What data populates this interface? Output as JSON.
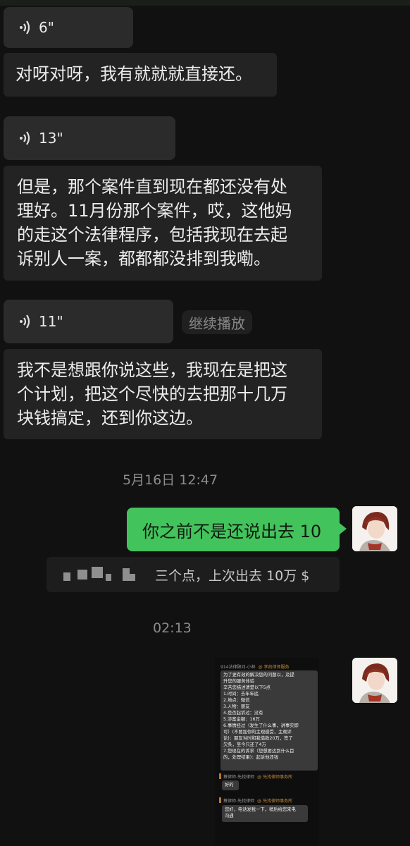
{
  "messages": {
    "voice1": {
      "duration": "6\""
    },
    "text1": "对呀对呀，我有就就就直接还。",
    "voice2": {
      "duration": "13\""
    },
    "text2_lines": [
      "但是，那个案件直到现在都还没有处",
      "理好。11月份那个案件，哎，这他妈",
      "的走这个法律程序，包括我现在去起",
      "诉别人一案，都都都没排到我嘞。"
    ],
    "voice3": {
      "duration": "11\""
    },
    "continue_play": "继续播放",
    "text3_lines": [
      "我不是想跟你说这些，我现在是把这",
      "个计划，把这个尽快的去把那十几万",
      "块钱搞定，还到你这边。"
    ],
    "timestamp1": "5月16日 12:47",
    "sent1": "你之前不是还说出去 10",
    "quote_reply": "三个点，上次出去 10万 $",
    "timestamp2": "02:13"
  },
  "screenshot": {
    "header1": {
      "name": "914法律顾问-小林",
      "brand": "@ 李凯律师服务"
    },
    "card1_lines": [
      "为了更有效的解决您的问题以，及提",
      "升您的服务体验",
      "辛苦您描述清楚以下5点",
      "1.时间：去年年底",
      "2.地点：微信",
      "3.人物：朋友",
      "4.是否起诉过：没有",
      "5.涉案金额：16万",
      "6.事情经过（发生了什么事，讲事实即",
      "可）(不要加你的主观感受，主观评",
      "论)：朋友当时和我借款20万，签了",
      "欠条，至今只还了4万",
      "7.您现在的诉求（您想要达到什么目",
      "的，处理结果)：起诉他还钱"
    ],
    "header2": {
      "name": "蔡律师-先找律师",
      "brand": "@ 先找律师事务所"
    },
    "card2_text": "好的",
    "header3": {
      "name": "蔡律师-先找律师",
      "brand": "@ 先找律师事务所"
    },
    "card3_lines": [
      "您好，电话发我一下，稍后给您来电",
      "沟通"
    ]
  },
  "colors": {
    "background": "#111111",
    "bubble": "#232323",
    "sent_bubble": "#43c35c",
    "brand": "#c48a3b"
  }
}
